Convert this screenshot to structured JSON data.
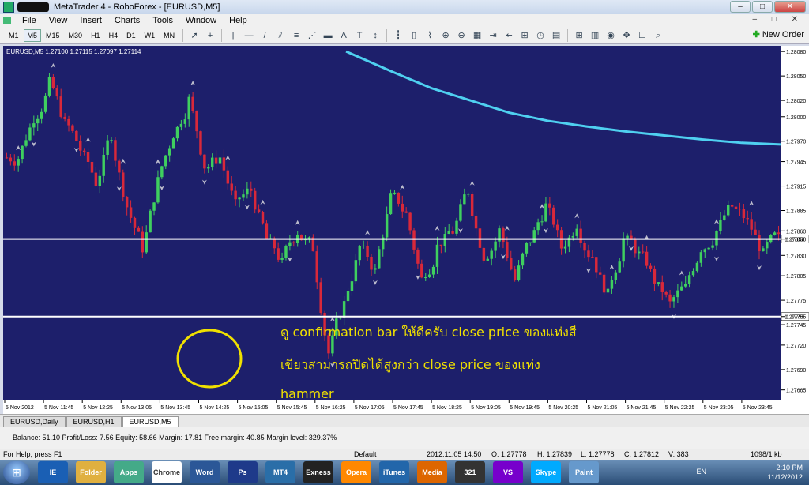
{
  "window": {
    "title": "MetaTrader 4 - RoboForex - [EURUSD,M5]"
  },
  "menu": [
    "File",
    "View",
    "Insert",
    "Charts",
    "Tools",
    "Window",
    "Help"
  ],
  "timeframes": [
    "M1",
    "M5",
    "M15",
    "M30",
    "H1",
    "H4",
    "D1",
    "W1",
    "MN"
  ],
  "active_timeframe": "M5",
  "toolbar": {
    "new_order": "New Order"
  },
  "chart": {
    "header": "EURUSD,M5  1.27100 1.27115 1.27097 1.27114",
    "annotation_lines": [
      "ดู confirmation bar ให้ดีครับ close price ของแท่งสี",
      "เขียวสามารถปิดได้สูงกว่า close price ของแท่ง",
      "hammer"
    ],
    "colors": {
      "background": "#1d1f6b",
      "bull": "#3fcf5f",
      "bear": "#d8283a",
      "ma": "#4fd0f0",
      "hline": "#ffffff",
      "annotation": "#f0e000"
    }
  },
  "chart_data": {
    "type": "candlestick",
    "symbol": "EURUSD",
    "timeframe": "M5",
    "ohlc_header": {
      "open": 1.271,
      "high": 1.27115,
      "low": 1.27097,
      "close": 1.27114
    },
    "price_ticks": [
      "1.28080",
      "1.28050",
      "1.28020",
      "1.28000",
      "1.27970",
      "1.27945",
      "1.27915",
      "1.27885",
      "1.27860",
      "1.27850",
      "1.27830",
      "1.27805",
      "1.27775",
      "1.27755",
      "1.27745",
      "1.27720",
      "1.27690",
      "1.27665"
    ],
    "time_ticks": [
      "5 Nov 2012",
      "5 Nov 11:45",
      "5 Nov 12:25",
      "5 Nov 13:05",
      "5 Nov 13:45",
      "5 Nov 14:25",
      "5 Nov 15:05",
      "5 Nov 15:45",
      "5 Nov 16:25",
      "5 Nov 17:05",
      "5 Nov 17:45",
      "5 Nov 18:25",
      "5 Nov 19:05",
      "5 Nov 19:45",
      "5 Nov 20:25",
      "5 Nov 21:05",
      "5 Nov 21:45",
      "5 Nov 22:25",
      "5 Nov 23:05",
      "5 Nov 23:45"
    ],
    "ylim": [
      1.27655,
      1.28085
    ],
    "horizontal_lines": [
      1.2785,
      1.27755
    ],
    "moving_average": {
      "x": [
        0.44,
        0.5,
        0.55,
        0.6,
        0.65,
        0.7,
        0.75,
        0.8,
        0.85,
        0.9,
        0.95,
        1.0
      ],
      "y": [
        1.2808,
        1.28055,
        1.28035,
        1.2802,
        1.28005,
        1.27995,
        1.27988,
        1.27982,
        1.27977,
        1.27972,
        1.27968,
        1.27966
      ]
    },
    "candles_close": [
      1.2795,
      1.28,
      1.2804,
      1.2799,
      1.2796,
      1.2792,
      1.2798,
      1.2789,
      1.2784,
      1.2792,
      1.2798,
      1.2802,
      1.2794,
      1.2795,
      1.2789,
      1.2791,
      1.2785,
      1.2782,
      1.2786,
      1.2784,
      1.2771,
      1.2777,
      1.2784,
      1.2781,
      1.279,
      1.2788,
      1.278,
      1.2784,
      1.2786,
      1.2791,
      1.2783,
      1.2786,
      1.278,
      1.2785,
      1.2789,
      1.2784,
      1.2787,
      1.2783,
      1.2778,
      1.2785,
      1.2783,
      1.278,
      1.2777,
      1.2779,
      1.2784,
      1.2786,
      1.2789,
      1.2787,
      1.2783,
      1.2785
    ]
  },
  "bottom_tabs": [
    "EURUSD,Daily",
    "EURUSD,H1",
    "EURUSD,M5"
  ],
  "active_tab": "EURUSD,M5",
  "account": {
    "line": "Balance: 51.10  Profit/Loss: 7.56  Equity: 58.66  Margin: 17.81  Free margin: 40.85  Margin level: 329.37%"
  },
  "status": {
    "help": "For Help, press F1",
    "profile": "Default",
    "time": "2012.11.05 14:50",
    "open": "O: 1.27778",
    "high": "H: 1.27839",
    "low": "L: 1.27778",
    "close": "C: 1.27812",
    "volume": "V: 383",
    "traffic": "1098/1 kb"
  },
  "taskbar": {
    "apps": [
      "IE",
      "Folder",
      "Apps",
      "Chrome",
      "Word",
      "Ps",
      "MT4",
      "Exness",
      "Opera",
      "iTunes",
      "Media",
      "321",
      "VS",
      "Skype",
      "Paint"
    ],
    "lang": "EN",
    "clock_time": "2:10 PM",
    "clock_date": "11/12/2012"
  }
}
